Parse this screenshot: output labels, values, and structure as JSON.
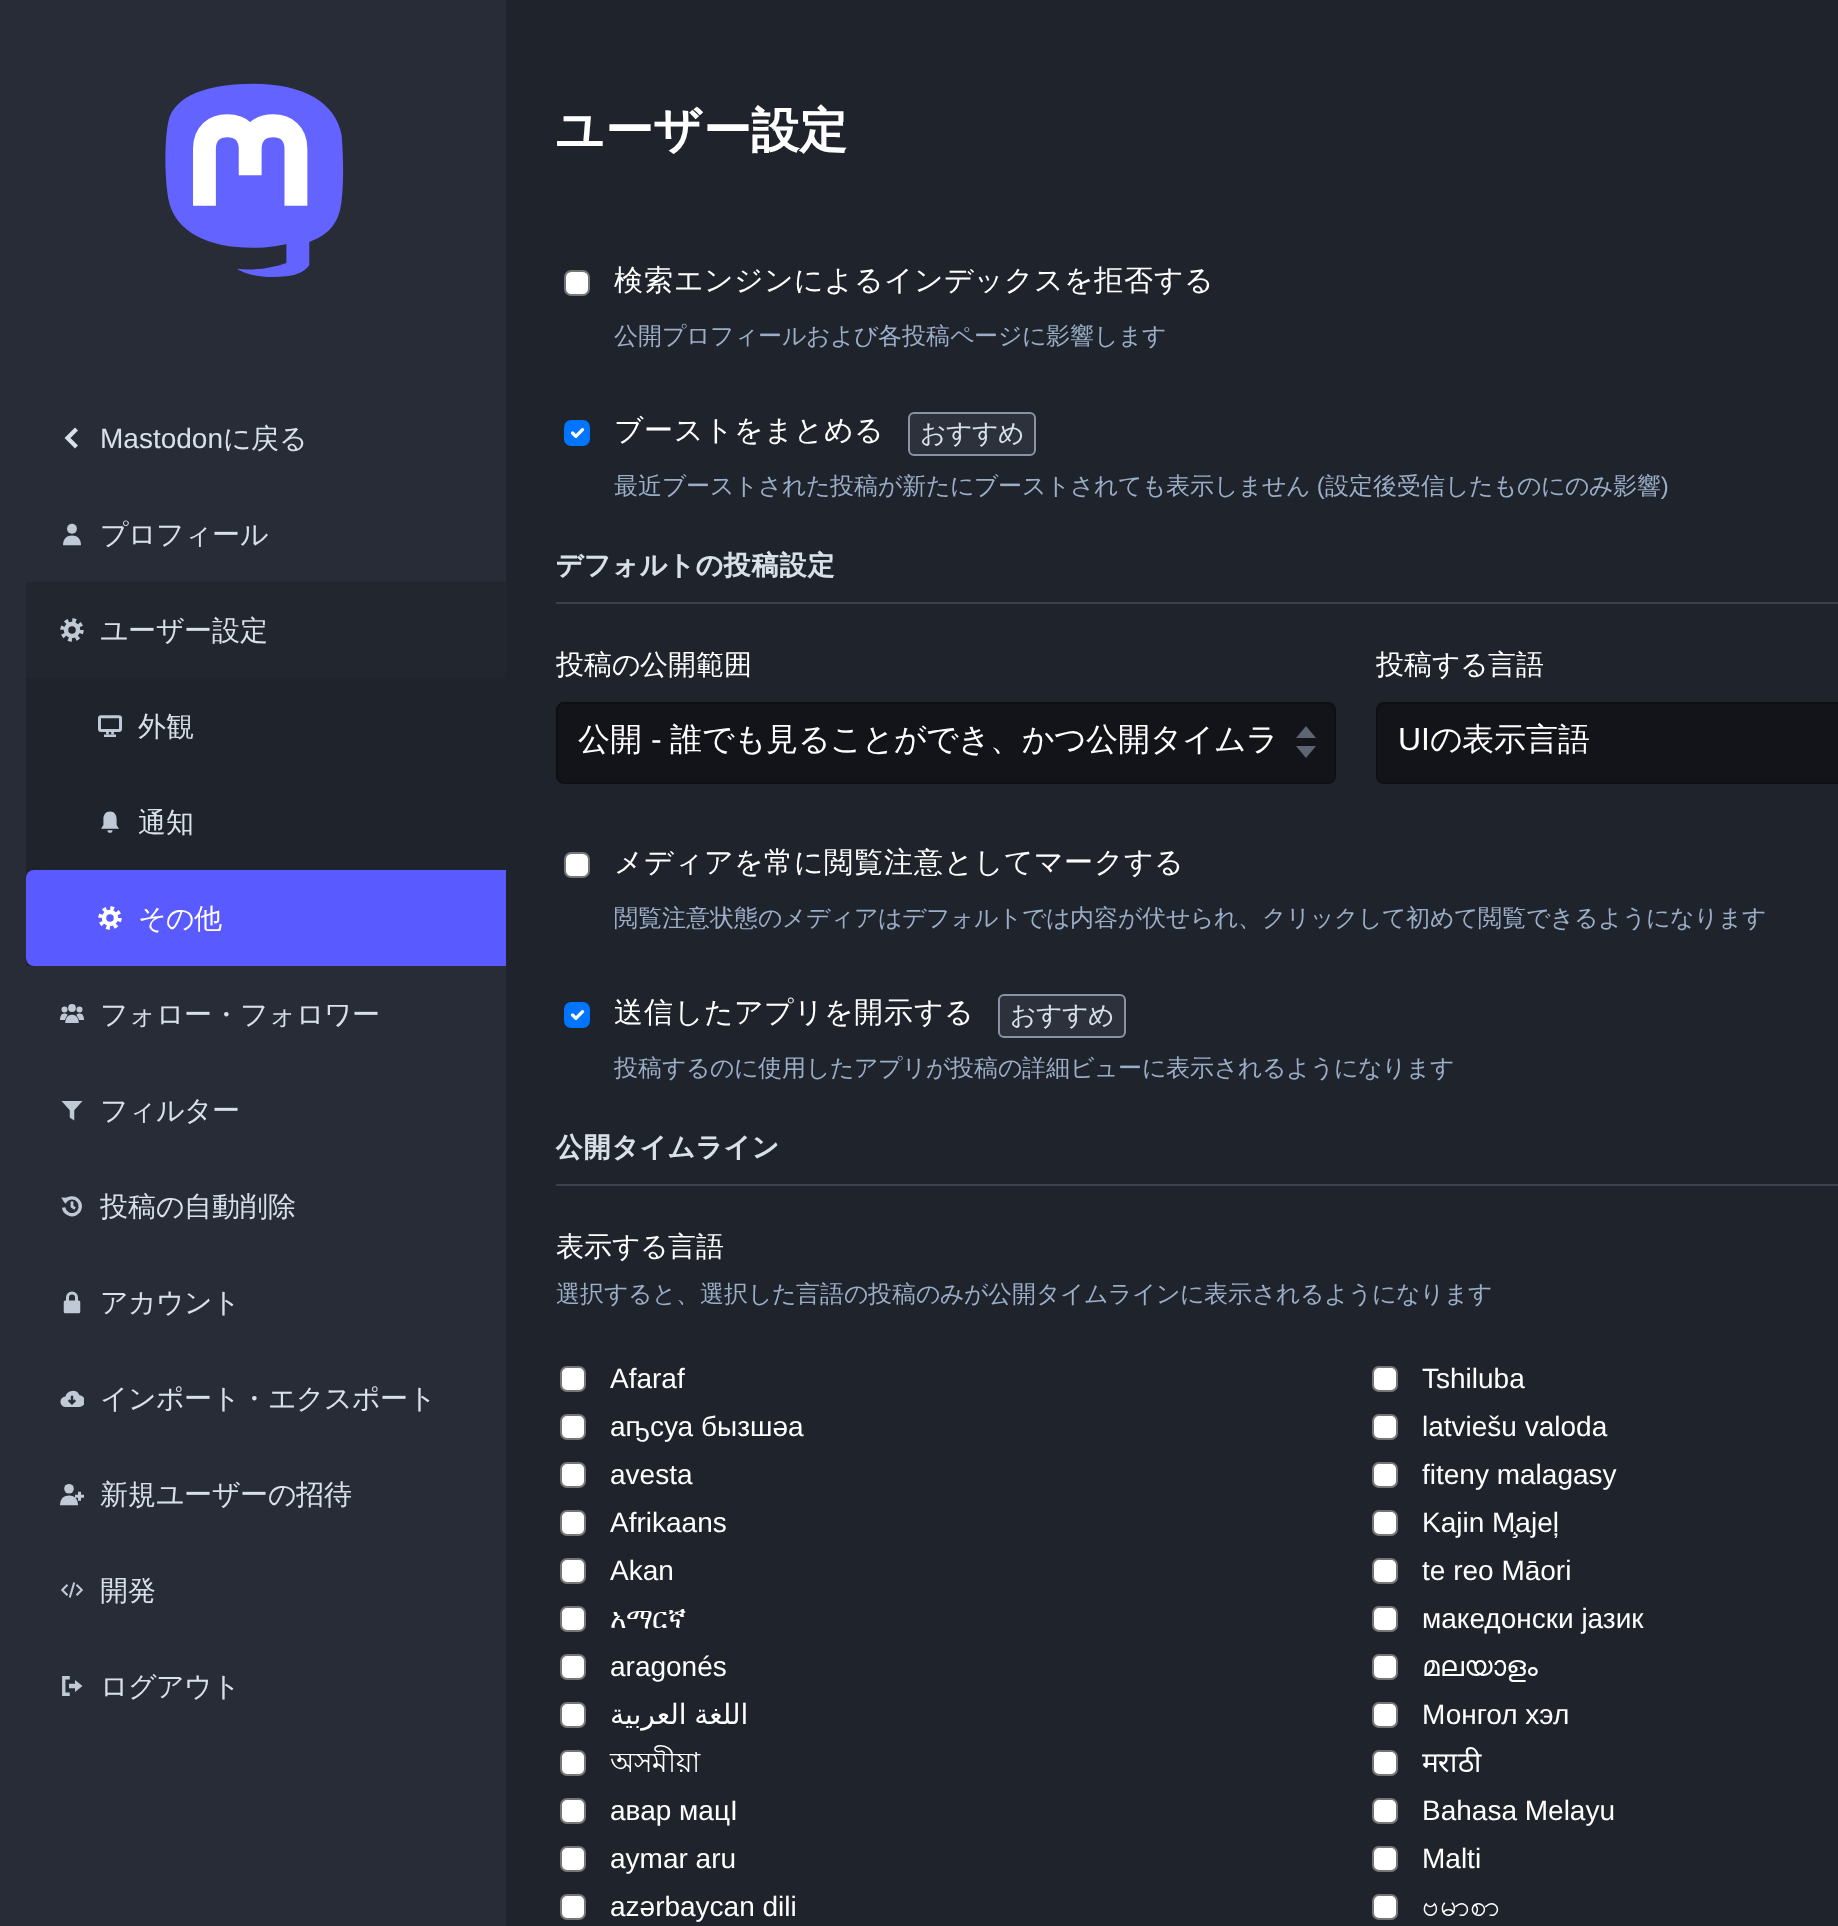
{
  "sidebar": {
    "back_link": {
      "label": "Mastodonに戻る"
    },
    "items": [
      {
        "label": "プロフィール",
        "selected": false
      },
      {
        "label": "ユーザー設定",
        "selected": false,
        "expanded": true,
        "children": [
          {
            "label": "外観",
            "selected": false
          },
          {
            "label": "通知",
            "selected": false
          },
          {
            "label": "その他",
            "selected": true
          }
        ]
      },
      {
        "label": "フォロー・フォロワー",
        "selected": false
      },
      {
        "label": "フィルター",
        "selected": false
      },
      {
        "label": "投稿の自動削除",
        "selected": false
      },
      {
        "label": "アカウント",
        "selected": false
      },
      {
        "label": "インポート・エクスポート",
        "selected": false
      },
      {
        "label": "新規ユーザーの招待",
        "selected": false
      },
      {
        "label": "開発",
        "selected": false
      },
      {
        "label": "ログアウト",
        "selected": false
      }
    ]
  },
  "page_title": "ユーザー設定",
  "sections": [
    {
      "kind": "checkbox",
      "label": "検索エンジンによるインデックスを拒否する",
      "hint": "公開プロフィールおよび各投稿ページに影響します",
      "checked": false
    },
    {
      "kind": "checkbox",
      "label": "ブーストをまとめる",
      "badge": "おすすめ",
      "hint": "最近ブーストされた投稿が新たにブーストされても表示しません (設定後受信したものにのみ影響)",
      "checked": true
    },
    {
      "kind": "heading",
      "label": "デフォルトの投稿設定"
    },
    {
      "kind": "selects",
      "selects": [
        {
          "label": "投稿の公開範囲",
          "value": "公開 - 誰でも見ることができ、かつ公開タイムラ"
        },
        {
          "label": "投稿する言語",
          "value": "UIの表示言語"
        }
      ]
    },
    {
      "kind": "checkbox",
      "label": "メディアを常に閲覧注意としてマークする",
      "hint": "閲覧注意状態のメディアはデフォルトでは内容が伏せられ、クリックして初めて閲覧できるようになります",
      "checked": false
    },
    {
      "kind": "checkbox",
      "label": "送信したアプリを開示する",
      "badge": "おすすめ",
      "hint": "投稿するのに使用したアプリが投稿の詳細ビューに表示されるようになります",
      "checked": true
    },
    {
      "kind": "heading",
      "label": "公開タイムライン"
    },
    {
      "kind": "languages",
      "label": "表示する言語",
      "hint": "選択すると、選択した言語の投稿のみが公開タイムラインに表示されるようになります",
      "columns": [
        [
          {
            "label": "Afaraf",
            "checked": false
          },
          {
            "label": "аҧсуа бызшәа",
            "checked": false
          },
          {
            "label": "avesta",
            "checked": false
          },
          {
            "label": "Afrikaans",
            "checked": false
          },
          {
            "label": "Akan",
            "checked": false
          },
          {
            "label": "አማርኛ",
            "checked": false
          },
          {
            "label": "aragonés",
            "checked": false
          },
          {
            "label": "اللغة العربية",
            "checked": false
          },
          {
            "label": "অসমীয়া",
            "checked": false
          },
          {
            "label": "авар мацӀ",
            "checked": false
          },
          {
            "label": "aymar aru",
            "checked": false
          },
          {
            "label": "azərbaycan dili",
            "checked": false
          }
        ],
        [
          {
            "label": "Tshiluba",
            "checked": false
          },
          {
            "label": "latviešu valoda",
            "checked": false
          },
          {
            "label": "fiteny malagasy",
            "checked": false
          },
          {
            "label": "Kajin M̧ajeļ",
            "checked": false
          },
          {
            "label": "te reo Māori",
            "checked": false
          },
          {
            "label": "македонски јазик",
            "checked": false
          },
          {
            "label": "മലയാളം",
            "checked": false
          },
          {
            "label": "Монгол хэл",
            "checked": false
          },
          {
            "label": "मराठी",
            "checked": false
          },
          {
            "label": "Bahasa Melayu",
            "checked": false
          },
          {
            "label": "Malti",
            "checked": false
          },
          {
            "label": "ဗမာစာ",
            "checked": false
          }
        ]
      ]
    }
  ]
}
